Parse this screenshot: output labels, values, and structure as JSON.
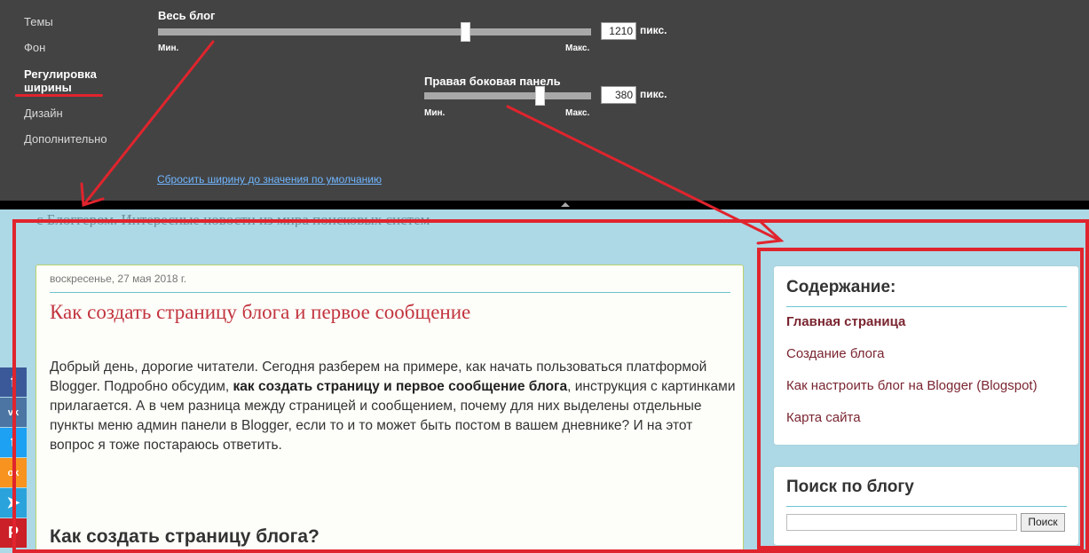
{
  "designer": {
    "nav": {
      "themes": "Темы",
      "background": "Фон",
      "width_line1": "Регулировка",
      "width_line2": "ширины",
      "layout": "Дизайн",
      "advanced": "Дополнительно"
    },
    "blog_width": {
      "title": "Весь блог",
      "min": "Мин.",
      "max": "Макс.",
      "value": "1210",
      "unit": "пикс.",
      "slider_position": 0.71
    },
    "sidebar_width": {
      "title": "Правая боковая панель",
      "min": "Мин.",
      "max": "Макс.",
      "value": "380",
      "unit": "пикс.",
      "slider_position": 0.69
    },
    "reset_link": "Сбросить ширину до значения по умолчанию"
  },
  "blog": {
    "description": "с Блоггером. Интересные новости из мира поисковых систем"
  },
  "post": {
    "date": "воскресенье, 27 мая 2018 г.",
    "title": "Как создать страницу блога и первое сообщение",
    "body_part1": "Добрый день, дорогие читатели. Сегодня разберем на примере, как начать пользоваться платформой Blogger. Подробно обсудим, ",
    "body_bold": "как создать страницу и первое сообщение блога",
    "body_part2": ", инструкция с картинками прилагается. А в чем разница между страницей и сообщением, почему для них выделены отдельные пункты меню админ панели в Blogger, если то и то может быть постом в вашем дневнике? И на этот вопрос я тоже постараюсь ответить.",
    "subheading": "Как создать страницу блога?"
  },
  "sidebar": {
    "contents": {
      "title": "Содержание:",
      "links": [
        "Главная страница",
        "Создание блога",
        "Как настроить блог на Blogger (Blogspot)",
        "Карта сайта"
      ]
    },
    "search": {
      "title": "Поиск по блогу",
      "button": "Поиск"
    }
  },
  "social": [
    {
      "icon": "facebook-icon",
      "glyph": "f",
      "color": "#3b5998"
    },
    {
      "icon": "vk-icon",
      "glyph": "vk",
      "color": "#4c75a3"
    },
    {
      "icon": "twitter-icon",
      "glyph": "t",
      "color": "#1da1f2"
    },
    {
      "icon": "odnoklassniki-icon",
      "glyph": "ok",
      "color": "#f7931e"
    },
    {
      "icon": "telegram-icon",
      "glyph": "➤",
      "color": "#2aa3dd"
    },
    {
      "icon": "pinterest-icon",
      "glyph": "P",
      "color": "#cb2027"
    }
  ],
  "annotation_color": "#e0242d"
}
